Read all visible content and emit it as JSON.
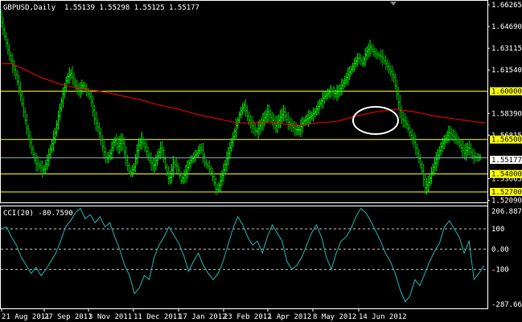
{
  "header": {
    "symbol_label": "GBPUSD,Daily",
    "ohlc_text": "1.55139 1.55298 1.55125 1.55177"
  },
  "colors": {
    "background": "#000000",
    "bull_bar": "#00ff00",
    "bear_bar": "#00c000",
    "moving_average": "#ff0000",
    "level_line": "#ffff00",
    "current_price_line": "#7f9f9f",
    "cci_line": "#20b2aa",
    "axis": "#ffffff",
    "annotation_circle": "#ffffff"
  },
  "price_axis": {
    "ticks": [
      "1.66265",
      "1.64690",
      "1.63115",
      "1.61540",
      "1.58390",
      "1.56815",
      "1.53665",
      "1.52090"
    ],
    "level_labels": [
      "1.60000",
      "1.56500",
      "1.54000",
      "1.52700"
    ],
    "current_label": "1.55177"
  },
  "indicator": {
    "title": "CCI(20) -80.7590",
    "ticks": [
      "206.8876",
      "100",
      "0.00",
      "-100",
      "-287.667"
    ]
  },
  "date_axis": {
    "labels": [
      "21 Aug 2011",
      "27 Sep 2011",
      "3 Nov 2011",
      "11 Dec 2011",
      "17 Jan 2012",
      "23 Feb 2012",
      "1 Apr 2012",
      "8 May 2012",
      "14 Jun 2012"
    ]
  },
  "chart_data": {
    "type": "line",
    "symbol": "GBPUSD",
    "timeframe": "Daily",
    "last": {
      "open": 1.55139,
      "high": 1.55298,
      "low": 1.55125,
      "close": 1.55177
    },
    "ylim": [
      1.52,
      1.665
    ],
    "horizontal_levels": [
      1.6,
      1.565,
      1.54,
      1.527
    ],
    "price_series": [
      [
        0,
        1.655
      ],
      [
        4,
        1.642
      ],
      [
        8,
        1.63
      ],
      [
        12,
        1.62
      ],
      [
        16,
        1.612
      ],
      [
        20,
        1.6
      ],
      [
        24,
        1.585
      ],
      [
        28,
        1.57
      ],
      [
        32,
        1.558
      ],
      [
        36,
        1.548
      ],
      [
        40,
        1.546
      ],
      [
        44,
        1.542
      ],
      [
        48,
        1.55
      ],
      [
        52,
        1.56
      ],
      [
        56,
        1.57
      ],
      [
        60,
        1.585
      ],
      [
        64,
        1.598
      ],
      [
        68,
        1.61
      ],
      [
        72,
        1.613
      ],
      [
        76,
        1.605
      ],
      [
        80,
        1.6
      ],
      [
        84,
        1.605
      ],
      [
        88,
        1.6
      ],
      [
        92,
        1.595
      ],
      [
        96,
        1.58
      ],
      [
        100,
        1.572
      ],
      [
        104,
        1.56
      ],
      [
        108,
        1.55
      ],
      [
        112,
        1.555
      ],
      [
        116,
        1.565
      ],
      [
        120,
        1.56
      ],
      [
        124,
        1.565
      ],
      [
        128,
        1.55
      ],
      [
        132,
        1.54
      ],
      [
        136,
        1.545
      ],
      [
        140,
        1.56
      ],
      [
        144,
        1.565
      ],
      [
        148,
        1.558
      ],
      [
        152,
        1.55
      ],
      [
        156,
        1.545
      ],
      [
        160,
        1.553
      ],
      [
        164,
        1.56
      ],
      [
        168,
        1.545
      ],
      [
        172,
        1.535
      ],
      [
        176,
        1.548
      ],
      [
        180,
        1.545
      ],
      [
        184,
        1.535
      ],
      [
        188,
        1.54
      ],
      [
        192,
        1.548
      ],
      [
        196,
        1.552
      ],
      [
        200,
        1.555
      ],
      [
        204,
        1.56
      ],
      [
        208,
        1.548
      ],
      [
        212,
        1.545
      ],
      [
        216,
        1.538
      ],
      [
        220,
        1.527
      ],
      [
        224,
        1.535
      ],
      [
        228,
        1.545
      ],
      [
        232,
        1.555
      ],
      [
        236,
        1.565
      ],
      [
        240,
        1.575
      ],
      [
        244,
        1.585
      ],
      [
        248,
        1.59
      ],
      [
        252,
        1.58
      ],
      [
        256,
        1.575
      ],
      [
        260,
        1.57
      ],
      [
        264,
        1.575
      ],
      [
        268,
        1.58
      ],
      [
        272,
        1.585
      ],
      [
        276,
        1.58
      ],
      [
        280,
        1.575
      ],
      [
        284,
        1.58
      ],
      [
        288,
        1.585
      ],
      [
        292,
        1.578
      ],
      [
        296,
        1.575
      ],
      [
        300,
        1.572
      ],
      [
        304,
        1.572
      ],
      [
        308,
        1.578
      ],
      [
        312,
        1.58
      ],
      [
        316,
        1.582
      ],
      [
        320,
        1.585
      ],
      [
        324,
        1.59
      ],
      [
        328,
        1.595
      ],
      [
        332,
        1.598
      ],
      [
        336,
        1.6
      ],
      [
        340,
        1.598
      ],
      [
        344,
        1.6
      ],
      [
        348,
        1.605
      ],
      [
        352,
        1.61
      ],
      [
        356,
        1.615
      ],
      [
        360,
        1.62
      ],
      [
        364,
        1.625
      ],
      [
        368,
        1.62
      ],
      [
        372,
        1.628
      ],
      [
        376,
        1.632
      ],
      [
        380,
        1.628
      ],
      [
        384,
        1.626
      ],
      [
        388,
        1.625
      ],
      [
        392,
        1.62
      ],
      [
        396,
        1.615
      ],
      [
        400,
        1.61
      ],
      [
        404,
        1.595
      ],
      [
        408,
        1.58
      ],
      [
        412,
        1.578
      ],
      [
        416,
        1.57
      ],
      [
        420,
        1.565
      ],
      [
        424,
        1.555
      ],
      [
        428,
        1.545
      ],
      [
        432,
        1.53
      ],
      [
        436,
        1.535
      ],
      [
        440,
        1.545
      ],
      [
        444,
        1.552
      ],
      [
        448,
        1.56
      ],
      [
        452,
        1.565
      ],
      [
        456,
        1.57
      ],
      [
        460,
        1.568
      ],
      [
        464,
        1.565
      ],
      [
        468,
        1.56
      ],
      [
        472,
        1.555
      ],
      [
        476,
        1.56
      ],
      [
        480,
        1.553
      ],
      [
        484,
        1.552
      ],
      [
        488,
        1.552
      ]
    ],
    "ma_series": [
      [
        0,
        1.62
      ],
      [
        10,
        1.62
      ],
      [
        20,
        1.617
      ],
      [
        40,
        1.61
      ],
      [
        60,
        1.605
      ],
      [
        80,
        1.602
      ],
      [
        100,
        1.6
      ],
      [
        120,
        1.597
      ],
      [
        140,
        1.594
      ],
      [
        160,
        1.59
      ],
      [
        180,
        1.587
      ],
      [
        200,
        1.583
      ],
      [
        220,
        1.58
      ],
      [
        240,
        1.577
      ],
      [
        260,
        1.577
      ],
      [
        280,
        1.577
      ],
      [
        300,
        1.575
      ],
      [
        320,
        1.577
      ],
      [
        340,
        1.578
      ],
      [
        360,
        1.582
      ],
      [
        380,
        1.585
      ],
      [
        400,
        1.587
      ],
      [
        420,
        1.585
      ],
      [
        440,
        1.582
      ],
      [
        460,
        1.58
      ],
      [
        480,
        1.578
      ],
      [
        492,
        1.577
      ]
    ],
    "cci_series": [
      [
        0,
        100
      ],
      [
        5,
        110
      ],
      [
        10,
        60
      ],
      [
        15,
        20
      ],
      [
        20,
        -40
      ],
      [
        25,
        -80
      ],
      [
        30,
        -120
      ],
      [
        35,
        -90
      ],
      [
        40,
        -130
      ],
      [
        45,
        -100
      ],
      [
        50,
        -60
      ],
      [
        55,
        -20
      ],
      [
        60,
        40
      ],
      [
        65,
        110
      ],
      [
        70,
        140
      ],
      [
        75,
        180
      ],
      [
        80,
        200
      ],
      [
        85,
        150
      ],
      [
        90,
        170
      ],
      [
        95,
        130
      ],
      [
        100,
        160
      ],
      [
        105,
        110
      ],
      [
        110,
        130
      ],
      [
        115,
        60
      ],
      [
        120,
        0
      ],
      [
        125,
        -80
      ],
      [
        130,
        -130
      ],
      [
        135,
        -220
      ],
      [
        140,
        -190
      ],
      [
        145,
        -130
      ],
      [
        150,
        -150
      ],
      [
        155,
        -40
      ],
      [
        160,
        20
      ],
      [
        165,
        60
      ],
      [
        170,
        110
      ],
      [
        175,
        70
      ],
      [
        180,
        30
      ],
      [
        185,
        -30
      ],
      [
        190,
        -110
      ],
      [
        195,
        -60
      ],
      [
        200,
        -20
      ],
      [
        205,
        -80
      ],
      [
        210,
        -120
      ],
      [
        215,
        -150
      ],
      [
        220,
        -120
      ],
      [
        225,
        -60
      ],
      [
        230,
        20
      ],
      [
        235,
        100
      ],
      [
        240,
        160
      ],
      [
        245,
        120
      ],
      [
        250,
        60
      ],
      [
        255,
        20
      ],
      [
        260,
        40
      ],
      [
        265,
        -20
      ],
      [
        270,
        60
      ],
      [
        275,
        120
      ],
      [
        280,
        80
      ],
      [
        285,
        40
      ],
      [
        290,
        -60
      ],
      [
        295,
        -100
      ],
      [
        300,
        -80
      ],
      [
        305,
        -40
      ],
      [
        310,
        20
      ],
      [
        315,
        80
      ],
      [
        320,
        120
      ],
      [
        325,
        60
      ],
      [
        330,
        -40
      ],
      [
        335,
        -100
      ],
      [
        340,
        -20
      ],
      [
        345,
        40
      ],
      [
        350,
        60
      ],
      [
        355,
        100
      ],
      [
        360,
        160
      ],
      [
        365,
        200
      ],
      [
        370,
        180
      ],
      [
        375,
        140
      ],
      [
        380,
        90
      ],
      [
        385,
        40
      ],
      [
        390,
        -20
      ],
      [
        395,
        -60
      ],
      [
        400,
        -120
      ],
      [
        405,
        -200
      ],
      [
        410,
        -260
      ],
      [
        415,
        -230
      ],
      [
        420,
        -150
      ],
      [
        425,
        -180
      ],
      [
        430,
        -120
      ],
      [
        435,
        -60
      ],
      [
        440,
        -10
      ],
      [
        445,
        30
      ],
      [
        450,
        110
      ],
      [
        455,
        140
      ],
      [
        460,
        100
      ],
      [
        465,
        60
      ],
      [
        470,
        -20
      ],
      [
        475,
        40
      ],
      [
        480,
        -150
      ],
      [
        485,
        -120
      ],
      [
        490,
        -81
      ]
    ],
    "annotation": "ellipse near the moving average around late May 2012"
  }
}
